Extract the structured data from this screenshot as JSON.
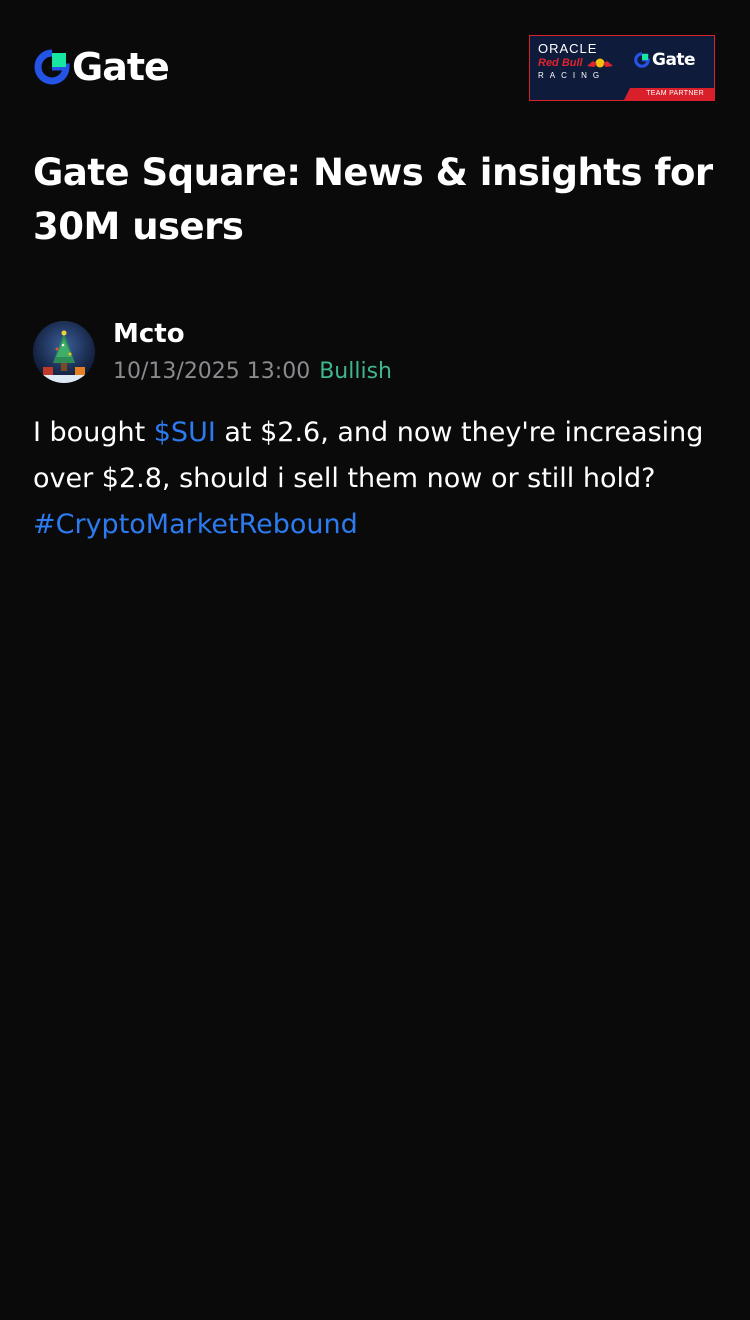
{
  "header": {
    "logo_text": "Gate",
    "logo_icon": "gate-logo-icon",
    "partner_badge": {
      "oracle": "ORACLE",
      "red_bull": "Red Bull",
      "racing": "RACING",
      "gate": "Gate",
      "team_partner": "TEAM PARTNER"
    }
  },
  "page": {
    "title": "Gate Square: News & insights for 30M users"
  },
  "post": {
    "author": "Mcto",
    "timestamp": "10/13/2025 13:00",
    "sentiment": "Bullish",
    "body_part1": "I bought ",
    "ticker": "$SUI",
    "body_part2": " at $2.6, and now they're increasing over $2.8, should i sell them now or still hold?",
    "hashtag": "#CryptoMarketRebound"
  },
  "colors": {
    "background": "#0a0a0b",
    "link": "#2d7bf0",
    "bullish": "#3fb68b",
    "muted": "#8a8a8f",
    "gate_blue": "#2354e6",
    "gate_green": "#17e6a1"
  }
}
